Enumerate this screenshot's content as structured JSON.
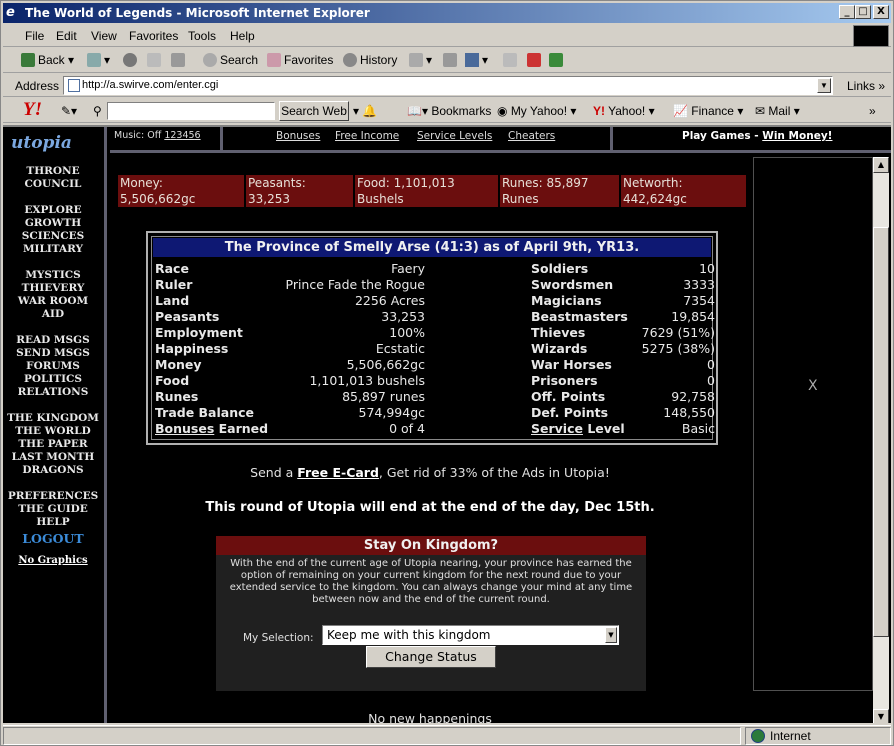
{
  "window": {
    "title": "The World of Legends - Microsoft Internet Explorer",
    "min_glyph": "_",
    "max_glyph": "□",
    "close_glyph": "X"
  },
  "menubar": [
    "File",
    "Edit",
    "View",
    "Favorites",
    "Tools",
    "Help"
  ],
  "toolbar": {
    "back": "Back",
    "search": "Search",
    "favorites": "Favorites",
    "history": "History"
  },
  "address": {
    "label": "Address",
    "url": "http://a.swirve.com/enter.cgi",
    "links": "Links"
  },
  "yahoo": {
    "logo": "Y!",
    "search_value": "",
    "search_button": "Search Web",
    "bookmarks": "Bookmarks",
    "my_yahoo": "My Yahoo!",
    "yahoo": "Yahoo!",
    "finance": "Finance",
    "mail": "Mail"
  },
  "sidebar": {
    "logo": "utopia",
    "groups": [
      [
        "THRONE",
        "COUNCIL"
      ],
      [
        "EXPLORE",
        "GROWTH",
        "SCIENCES",
        "MILITARY"
      ],
      [
        "MYSTICS",
        "THIEVERY",
        "WAR ROOM",
        "AID"
      ],
      [
        "READ MSGS",
        "SEND MSGS",
        "FORUMS",
        "POLITICS",
        "RELATIONS"
      ],
      [
        "THE KINGDOM",
        "THE WORLD",
        "THE PAPER",
        "LAST MONTH",
        "DRAGONS"
      ],
      [
        "PREFERENCES",
        "THE GUIDE",
        "HELP"
      ]
    ],
    "logout": "LOGOUT",
    "no_graphics": "No Graphics"
  },
  "topstrip": {
    "music_label": "Music: Off",
    "music_tracks": [
      "1",
      "2",
      "3",
      "4",
      "5",
      "6"
    ],
    "bonuses": "Bonuses",
    "free_income": "Free Income",
    "service_levels": "Service Levels",
    "cheaters": "Cheaters",
    "play_games": "Play Games - ",
    "win_money": "Win Money!"
  },
  "stats": [
    {
      "label": "Money:",
      "value": "5,506,662gc"
    },
    {
      "label": "Peasants:",
      "value": "33,253"
    },
    {
      "label": "Food: 1,101,013",
      "value": "Bushels"
    },
    {
      "label": "Runes: 85,897",
      "value": "Runes"
    },
    {
      "label": "Networth:",
      "value": "442,624gc"
    }
  ],
  "province": {
    "title": "The Province of Smelly Arse (41:3) as of April 9th, YR13.",
    "left": [
      {
        "label": "Race",
        "value": "Faery"
      },
      {
        "label": "Ruler",
        "value": "Prince Fade the Rogue"
      },
      {
        "label": "Land",
        "value": "2256 Acres"
      },
      {
        "label": "Peasants",
        "value": "33,253"
      },
      {
        "label": "Employment",
        "value": "100%"
      },
      {
        "label": "Happiness",
        "value": "Ecstatic"
      },
      {
        "label": "Money",
        "value": "5,506,662gc"
      },
      {
        "label": "Food",
        "value": "1,101,013 bushels"
      },
      {
        "label": "Runes",
        "value": "85,897 runes"
      },
      {
        "label": "Trade Balance",
        "value": "574,994gc"
      }
    ],
    "right": [
      {
        "label": "Soldiers",
        "value": "10"
      },
      {
        "label": "Swordsmen",
        "value": "3333"
      },
      {
        "label": "Magicians",
        "value": "7354"
      },
      {
        "label": "Beastmasters",
        "value": "19,854"
      },
      {
        "label": "Thieves",
        "value": "7629 (51%)"
      },
      {
        "label": "Wizards",
        "value": "5275 (38%)"
      },
      {
        "label": "War Horses",
        "value": "0"
      },
      {
        "label": "Prisoners",
        "value": "0"
      },
      {
        "label": "Off. Points",
        "value": "92,758"
      },
      {
        "label": "Def. Points",
        "value": "148,550"
      }
    ],
    "bonuses_link": "Bonuses",
    "bonuses_label": " Earned",
    "bonuses_value": "0 of 4",
    "service_link": "Service",
    "service_label": " Level",
    "service_value": "Basic"
  },
  "ecard": {
    "pre": "Send a ",
    "link": "Free E-Card",
    "post": ", Get rid of 33% of the Ads in Utopia!"
  },
  "round_end": "This round of Utopia will end at the end of the day, Dec 15th.",
  "stay": {
    "title": "Stay On Kingdom?",
    "text": "With the end of the current age of Utopia nearing, your province has earned the option of remaining on your current kingdom for the next round due to your extended service to the kingdom. You can always change your mind at any time between now and the end of the current round.",
    "selection_label": "My Selection:",
    "selection_value": "Keep me with this kingdom",
    "button": "Change Status"
  },
  "no_happenings": "No new happenings",
  "ad_close": "X",
  "status": {
    "zone": "Internet"
  },
  "colors": {
    "titlebar": "#0a246a",
    "stats_bg": "#6b0e0e",
    "province_title_bg": "#0e1873",
    "logout": "#3b8bd8"
  }
}
